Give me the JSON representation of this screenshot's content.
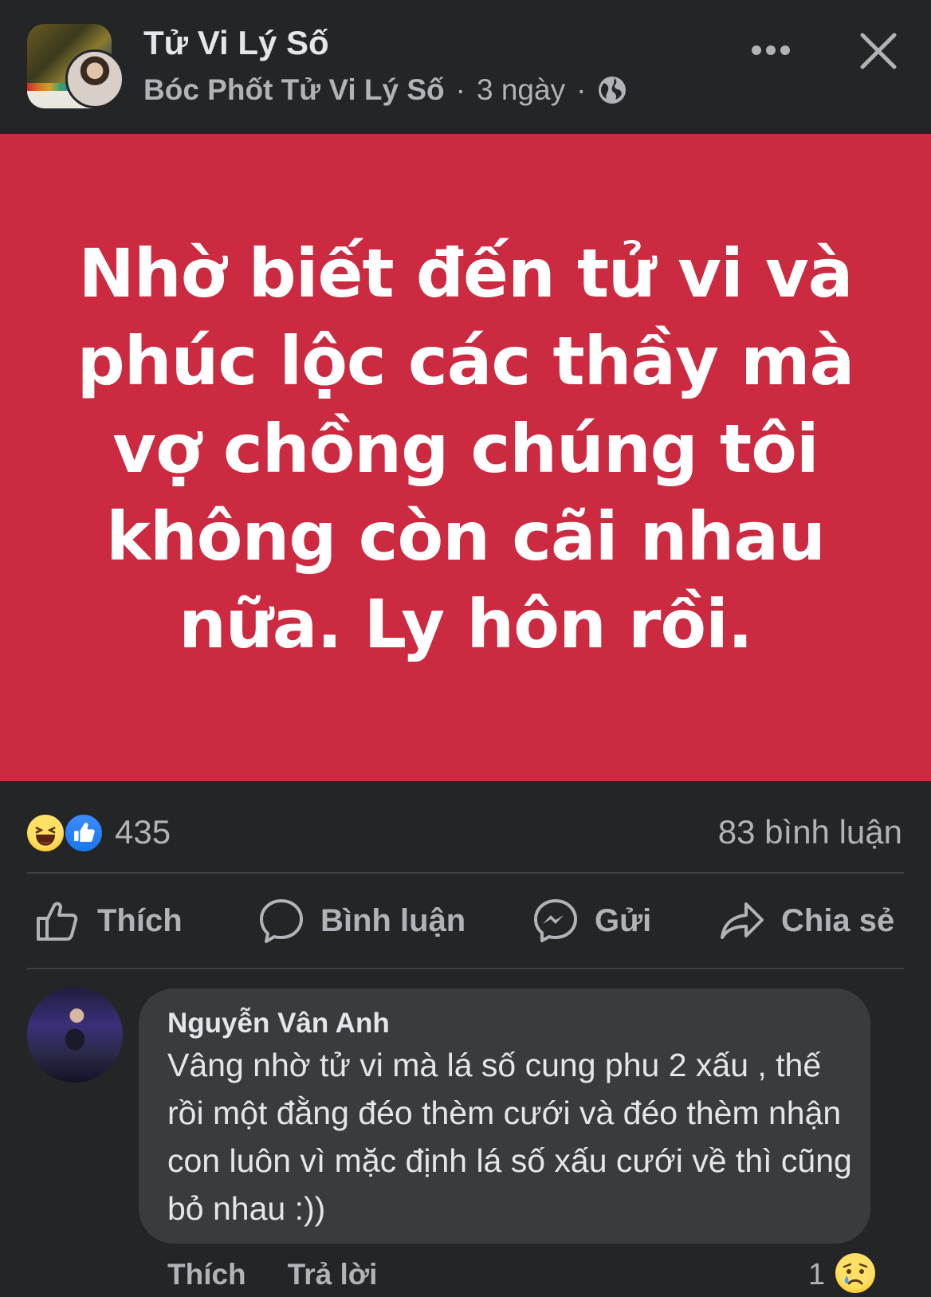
{
  "header": {
    "group_name": "Tử Vi Lý Số",
    "author": "Bóc Phốt Tử Vi Lý Số",
    "separator": "·",
    "time": "3 ngày",
    "privacy_icon": "globe-icon"
  },
  "post": {
    "banner_text": "Nhờ biết đến tử vi và phúc lộc các thầy mà vợ chồng chúng tôi không còn cãi nhau nữa. Ly hôn rồi.",
    "banner_color": "#cb2a41"
  },
  "reactions": {
    "icons": [
      "haha-emoji",
      "like-emoji"
    ],
    "count": "435",
    "comments": "83 bình luận"
  },
  "actions": {
    "like": "Thích",
    "comment": "Bình luận",
    "send": "Gửi",
    "share": "Chia sẻ"
  },
  "comment": {
    "author": "Nguyễn Vân Anh",
    "text": "Vâng nhờ tử vi mà lá số cung phu 2 xấu , thế rồi một đằng đéo thèm cưới và đéo thèm nhận con luôn vì mặc định lá số xấu cưới về thì cũng bỏ nhau :))",
    "like_label": "Thích",
    "reply_label": "Trả lời",
    "reaction_count": "1",
    "reaction_icon": "sad-emoji"
  },
  "colors": {
    "background": "#242526",
    "bubble": "#3a3b3c",
    "muted_text": "#b0b3b8",
    "primary_text": "#e4e6eb"
  }
}
